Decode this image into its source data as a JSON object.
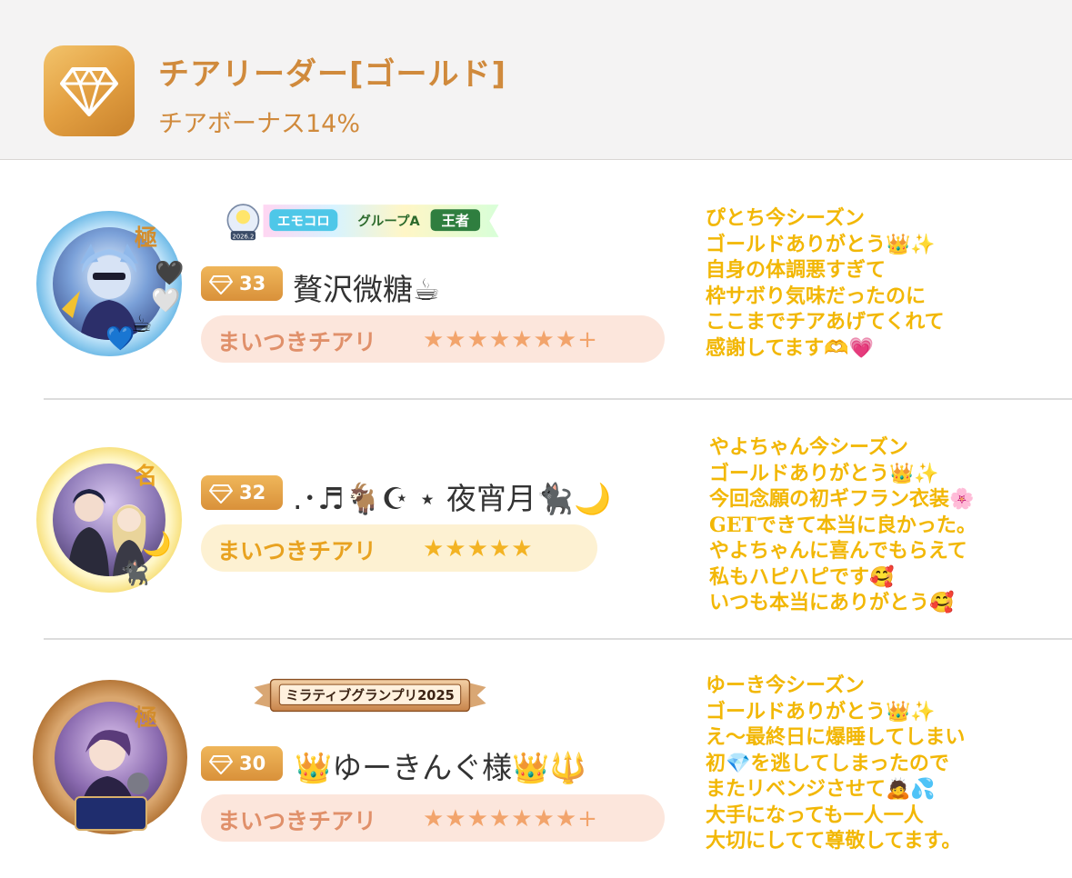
{
  "header": {
    "icon": "diamond-icon",
    "title": "チアリーダー[ゴールド]",
    "subtitle": "チアボーナス14%"
  },
  "colors": {
    "accent": "#d08a3c",
    "message": "#f2b705"
  },
  "rows": [
    {
      "rank_badge": "極",
      "title_banner": {
        "left_tag": "エモコロ",
        "mid": "グループA",
        "right": "王者",
        "year": "2026.2"
      },
      "cheer_count": "33",
      "username": "贅沢微糖☕",
      "pill_label": "まいつきチアリ",
      "stars": "★★★★★★★+",
      "stars_count": 7,
      "message": "ぴとち今シーズン\nゴールドありがとう👑✨\n自身の体調悪すぎて\n枠サボり気味だったのに\nここまでチアあげてくれて\n感謝してます🫶💗"
    },
    {
      "rank_badge": "名",
      "title_banner": null,
      "cheer_count": "32",
      "username": ".･♬🐐☪︎ ⋆ 夜宵月🐈‍⬛🌙",
      "pill_label": "まいつきチアリ",
      "stars": "★★★★★",
      "stars_count": 5,
      "message": "やよちゃん今シーズン\nゴールドありがとう👑✨\n今回念願の初ギフラン衣装🌸\nGETできて本当に良かった。\nやよちゃんに喜んでもらえて\n私もハピハピです🥰\nいつも本当にありがとう🥰"
    },
    {
      "rank_badge": "極",
      "title_banner": {
        "text": "ミラティブグランプリ2025"
      },
      "cheer_count": "30",
      "username": "👑ゆーきんぐ様👑🔱",
      "pill_label": "まいつきチアリ",
      "stars": "★★★★★★★+",
      "stars_count": 7,
      "message": "ゆーき今シーズン\nゴールドありがとう👑✨\nえ〜最終日に爆睡してしまい\n初💎を逃してしまったので\nまたリベンジさせて🙇💦\n大手になっても一人一人\n大切にしてて尊敬してます。"
    }
  ]
}
